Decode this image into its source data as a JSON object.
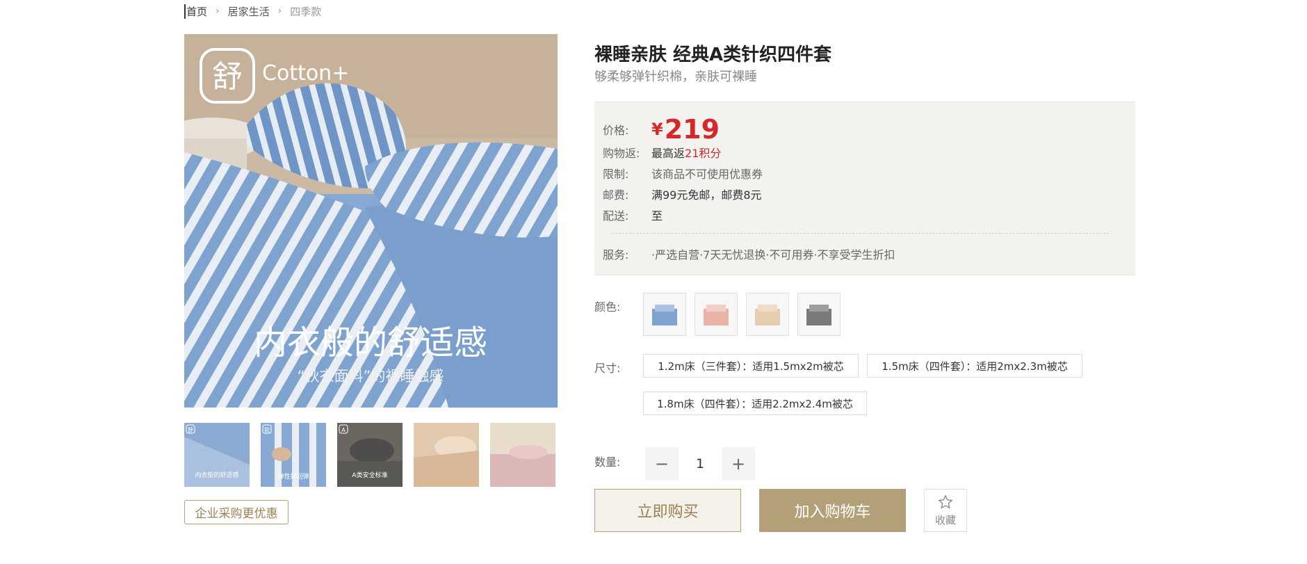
{
  "breadcrumb": {
    "home": "首页",
    "category": "居家生活",
    "current": "四季款"
  },
  "product": {
    "title": "裸睡亲肤 经典A类针织四件套",
    "subtitle": "够柔够弹针织棉，亲肤可裸睡",
    "image": {
      "brand_glyph": "舒",
      "brand_text": "Cotton+",
      "headline": "内衣般的舒适感",
      "subline": "“秋衣面料”的裸睡触感"
    },
    "thumbs": [
      {
        "tag": "舒",
        "caption": "内衣般的舒适感"
      },
      {
        "tag": "软",
        "caption": "弹性好回弹"
      },
      {
        "tag": "A",
        "caption": "A类安全标准"
      },
      {
        "tag": "",
        "caption": ""
      },
      {
        "tag": "",
        "caption": ""
      }
    ],
    "corporate_btn": "企业采购更优惠"
  },
  "info": {
    "price_label": "价格:",
    "price_symbol": "¥",
    "price_value": "219",
    "rebate_label": "购物返:",
    "rebate_prefix": "最高返",
    "rebate_points": "21积分",
    "limit_label": "限制:",
    "limit_value": "该商品不可使用优惠券",
    "shipping_label": "邮费:",
    "shipping_value": "满99元免邮，邮费8元",
    "delivery_label": "配送:",
    "delivery_value": "至",
    "service_label": "服务:",
    "service_value": "·严选自营·7天无忧退换·不可用券·不享受学生折扣"
  },
  "options": {
    "color_label": "颜色:",
    "colors": [
      {
        "name": "蓝色条纹",
        "hex": "#7fa3cf"
      },
      {
        "name": "粉色条纹",
        "hex": "#e8b3a6"
      },
      {
        "name": "米杏色",
        "hex": "#e5cdb0"
      },
      {
        "name": "灰色",
        "hex": "#7a7a7a"
      }
    ],
    "size_label": "尺寸:",
    "sizes": [
      "1.2m床（三件套）：适用1.5mx2m被芯",
      "1.5m床（四件套）：适用2mx2.3m被芯",
      "1.8m床（四件套）：适用2.2mx2.4m被芯"
    ],
    "qty_label": "数量:",
    "qty_value": "1",
    "minus": "−",
    "plus": "+"
  },
  "actions": {
    "buy_now": "立即购买",
    "add_cart": "加入购物车",
    "favorite": "收藏"
  },
  "colors": {
    "accent": "#b4a078",
    "price": "#d4282d",
    "info_bg": "#f4f2ee"
  }
}
